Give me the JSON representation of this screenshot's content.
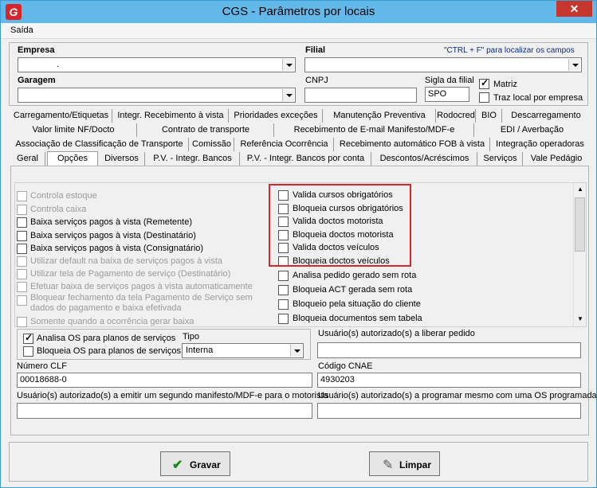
{
  "window": {
    "title": "CGS - Parâmetros por locais",
    "logo": "G"
  },
  "menu": {
    "saida": "Saída"
  },
  "header": {
    "empresa_label": "Empresa",
    "empresa_value": ".",
    "filial_label": "Filial",
    "search_hint": "\"CTRL + F\" para localizar os campos",
    "garagem_label": "Garagem",
    "cnpj_label": "CNPJ",
    "sigla_label": "Sigla da filial",
    "sigla_value": "SPO",
    "matriz_label": "Matriz",
    "traz_local_label": "Traz local por empresa"
  },
  "tabs": {
    "row1": [
      "Carregamento/Etiquetas",
      "Integr. Recebimento à vista",
      "Prioridades exceções",
      "Manutenção Preventiva",
      "Rodocred",
      "BIO",
      "Descarregamento"
    ],
    "row2": [
      "Valor limite NF/Docto",
      "Contrato de transporte",
      "Recebimento de E-mail Manifesto/MDF-e",
      "EDI / Averbação"
    ],
    "row3": [
      "Associação de Classificação de Transporte",
      "Comissão",
      "Referência Ocorrência",
      "Recebimento automático FOB à vista",
      "Integração operadoras"
    ],
    "row4": [
      "Geral",
      "Opções",
      "Diversos",
      "P.V. - Integr. Bancos",
      "P.V. - Integr. Bancos por conta",
      "Descontos/Acréscimos",
      "Serviços",
      "Vale Pedágio"
    ]
  },
  "options_left": [
    {
      "label": "Controla estoque",
      "enabled": false
    },
    {
      "label": "Controla caixa",
      "enabled": false
    },
    {
      "label": "Baixa serviços pagos à vista (Remetente)",
      "enabled": true
    },
    {
      "label": "Baixa serviços pagos à vista (Destinatário)",
      "enabled": true
    },
    {
      "label": "Baixa serviços pagos à vista (Consignatário)",
      "enabled": true
    },
    {
      "label": "Utilizar default na baixa de serviços pagos à vista",
      "enabled": false
    },
    {
      "label": "Utilizar tela de Pagamento de serviço (Destinatário)",
      "enabled": false
    },
    {
      "label": "Efetuar baixa de serviços pagos à vista automaticamente",
      "enabled": false
    },
    {
      "label": "Bloquear fechamento da tela Pagamento de Serviço sem",
      "label2": "dados do pagamento e baixa efetivada",
      "enabled": false
    },
    {
      "label": "Somente quando a ocorrência gerar baixa",
      "enabled": false
    }
  ],
  "options_right": [
    "Valida cursos obrigatórios",
    "Bloqueia cursos obrigatórios",
    "Valida doctos motorista",
    "Bloqueia doctos motorista",
    "Valida doctos veículos",
    "Bloqueia doctos veículos",
    "Analisa pedido gerado sem rota",
    "Bloqueia ACT gerada sem rota",
    "Bloqueio pela situação do cliente",
    "Bloqueia documentos sem tabela"
  ],
  "os_group": {
    "analisa_os": "Analisa OS para planos de serviços",
    "bloqueia_os": "Bloqueia OS para planos de serviços",
    "tipo_label": "Tipo",
    "tipo_value": "Interna"
  },
  "fields": {
    "usuarios_liberar_label": "Usuário(s) autorizado(s) a liberar pedido",
    "numero_clf_label": "Número CLF",
    "numero_clf_value": "00018688-0",
    "codigo_cnae_label": "Código CNAE",
    "codigo_cnae_value": "4930203",
    "usuarios_segundo_manifesto_label": "Usuário(s) autorizado(s) a emitir um segundo manifesto/MDF-e para o motorista",
    "usuarios_programar_label": "Usuário(s) autorizado(s) a programar mesmo com uma OS programada"
  },
  "buttons": {
    "gravar": "Gravar",
    "limpar": "Limpar"
  },
  "colors": {
    "titlebar": "#63b8ea",
    "highlight_box": "#d9262b",
    "close": "#c7362d"
  }
}
